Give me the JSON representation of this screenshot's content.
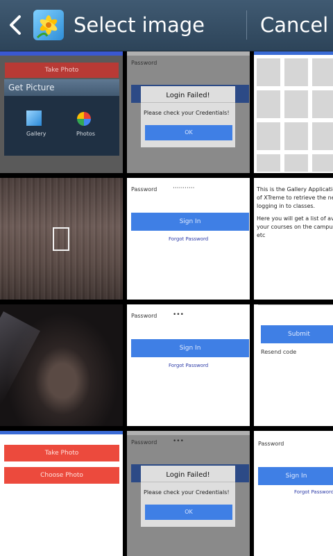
{
  "header": {
    "title": "Select image",
    "cancel_label": "Cancel",
    "colors": {
      "bar": "#34506a",
      "text": "#ffffff"
    }
  },
  "thumbnails": {
    "t00": {
      "take_photo": "Take Photo",
      "get_picture": "Get Picture",
      "gallery": "Gallery",
      "photos": "Photos"
    },
    "t01": {
      "password": "Password",
      "title": "Login Failed!",
      "message": "Please check your Credentials!",
      "ok": "OK"
    },
    "t11": {
      "password": "Password",
      "dots": "···········",
      "sign_in": "Sign In",
      "forgot": "Forgot Password"
    },
    "t12": {
      "lines": [
        "This is the Gallery Application",
        "of XTreme to retrieve the needed",
        "logging in to classes."
      ],
      "lines2": [
        "Here you will get a list of available",
        "your courses on the campus",
        "etc"
      ]
    },
    "t21": {
      "password": "Password",
      "dots": "•••",
      "sign_in": "Sign In",
      "forgot": "Forgot Password"
    },
    "t22": {
      "submit": "Submit",
      "resend": "Resend code"
    },
    "t30": {
      "take_photo": "Take Photo",
      "choose_photo": "Choose Photo"
    },
    "t31": {
      "password": "Password",
      "dots": "•••",
      "title": "Login Failed!",
      "message": "Please check your Credentials!",
      "ok": "OK"
    },
    "t32": {
      "password": "Password",
      "sign_in": "Sign In",
      "forgot": "Forgot Password"
    }
  }
}
